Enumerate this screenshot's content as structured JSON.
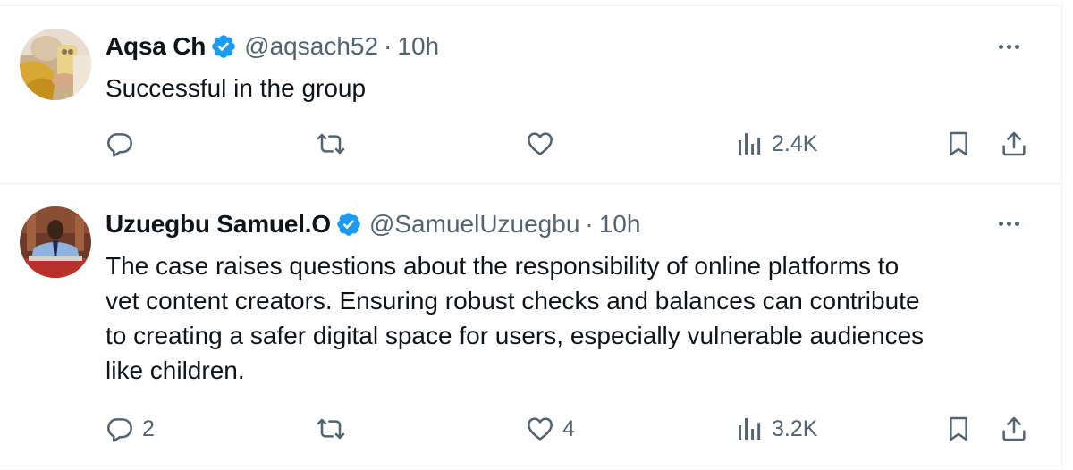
{
  "tweets": [
    {
      "author_name": "Aqsa Ch",
      "handle": "@aqsach52",
      "separator": "·",
      "time": "10h",
      "text_lines": [
        "Successful in the group"
      ],
      "replies": "",
      "retweets": "",
      "likes": "",
      "views": "2.4K"
    },
    {
      "author_name": "Uzuegbu Samuel.O",
      "handle": "@SamuelUzuegbu",
      "separator": "·",
      "time": "10h",
      "text_lines": [
        "The case raises questions about the responsibility of online platforms to",
        "vet content creators. Ensuring robust checks and balances can contribute",
        "to creating a safer digital space for users, especially vulnerable audiences",
        "like children."
      ],
      "replies": "2",
      "retweets": "",
      "likes": "4",
      "views": "3.2K"
    }
  ],
  "colors": {
    "verified": "#1d9bf0",
    "secondary_text": "#536471",
    "primary_text": "#0f1419",
    "divider": "#eff3f4"
  },
  "icons": [
    "verified-badge-icon",
    "more-icon",
    "reply-icon",
    "retweet-icon",
    "like-icon",
    "views-icon",
    "bookmark-icon",
    "share-icon"
  ]
}
